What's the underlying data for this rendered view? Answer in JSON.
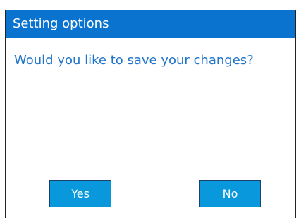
{
  "dialog": {
    "title": "Setting options",
    "message": "Would you like to save your changes?",
    "buttons": {
      "yes_label": "Yes",
      "no_label": "No"
    }
  },
  "colors": {
    "title_bar": "#0a73cf",
    "title_text": "#ffffff",
    "message_text": "#1f73c9",
    "button_bg": "#0a98dc",
    "button_border": "#1c3f6b",
    "button_text": "#ffffff"
  }
}
